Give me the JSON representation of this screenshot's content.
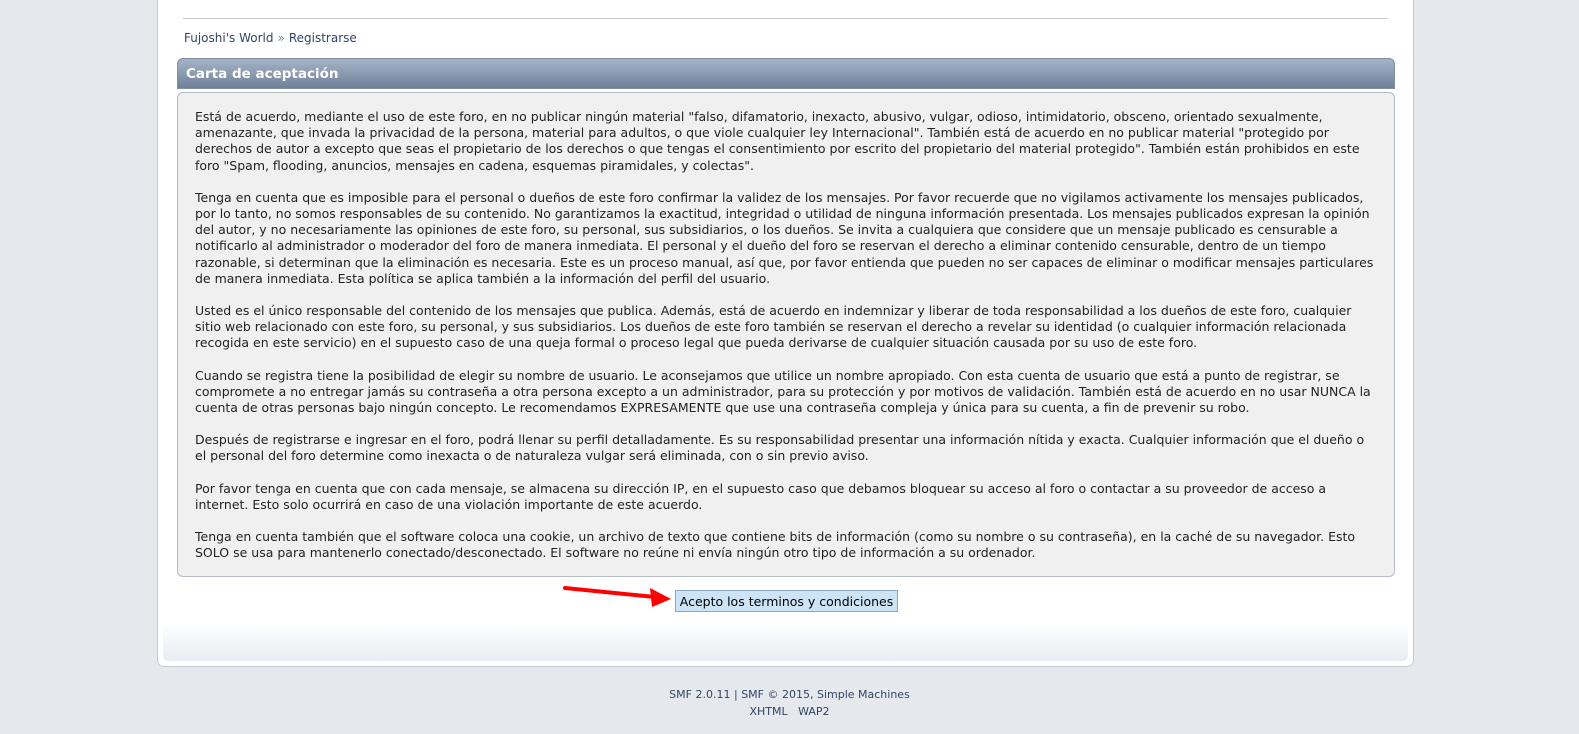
{
  "breadcrumb": {
    "home": "Fujoshi's World",
    "separator": "»",
    "current": "Registrarse"
  },
  "agreement": {
    "title": "Carta de aceptación",
    "paragraphs": [
      "Está de acuerdo, mediante el uso de este foro, en no publicar ningún material \"falso, difamatorio, inexacto, abusivo, vulgar, odioso, intimidatorio, obsceno, orientado sexualmente, amenazante, que invada la privacidad de la persona, material para adultos, o que viole cualquier ley Internacional\". También está de acuerdo en no publicar material \"protegido por derechos de autor a excepto que seas el propietario de los derechos o que tengas el consentimiento por escrito del propietario del material protegido\". También están prohibidos en este foro \"Spam, flooding, anuncios, mensajes en cadena, esquemas piramidales, y colectas\".",
      "Tenga en cuenta que es imposible para el personal o dueños de este foro confirmar la validez de los mensajes. Por favor recuerde que no vigilamos activamente los mensajes publicados, por lo tanto, no somos responsables de su contenido. No garantizamos la exactitud, integridad o utilidad de ninguna información presentada. Los mensajes publicados expresan la opinión del autor, y no necesariamente las opiniones de este foro, su personal, sus subsidiarios, o los dueños. Se invita a cualquiera que considere que un mensaje publicado es censurable a notificarlo al administrador o moderador del foro de manera inmediata. El personal y el dueño del foro se reservan el derecho a eliminar contenido censurable, dentro de un tiempo razonable, si determinan que la eliminación es necesaria. Este es un proceso manual, así que, por favor entienda que pueden no ser capaces de eliminar o modificar mensajes particulares de manera inmediata. Esta política se aplica también a la información del perfil del usuario.",
      "Usted es el único responsable del contenido de los mensajes que publica. Además, está de acuerdo en indemnizar y liberar de toda responsabilidad a los dueños de este foro, cualquier sitio web relacionado con este foro, su personal, y sus subsidiarios. Los dueños de este foro también se reservan el derecho a revelar su identidad (o cualquier información relacionada recogida en este servicio) en el supuesto caso de una queja formal o proceso legal que pueda derivarse de cualquier situación causada por su uso de este foro.",
      "Cuando se registra tiene la posibilidad de elegir su nombre de usuario. Le aconsejamos que utilice un nombre apropiado. Con esta cuenta de usuario que está a punto de registrar, se compromete a no entregar jamás su contraseña a otra persona excepto a un administrador, para su protección y por motivos de validación. También está de acuerdo en no usar NUNCA la cuenta de otras personas bajo ningún concepto. Le recomendamos EXPRESAMENTE que use una contraseña compleja y única para su cuenta, a fin de prevenir su robo.",
      "Después de registrarse e ingresar en el foro, podrá llenar su perfil detalladamente. Es su responsabilidad presentar una información nítida y exacta. Cualquier información que el dueño o el personal del foro determine como inexacta o de naturaleza vulgar será eliminada, con o sin previo aviso.",
      "Por favor tenga en cuenta que con cada mensaje, se almacena su dirección IP, en el supuesto caso que debamos bloquear su acceso al foro o contactar a su proveedor de acceso a internet. Esto solo ocurrirá en caso de una violación importante de este acuerdo.",
      "Tenga en cuenta también que el software coloca una cookie, un archivo de texto que contiene bits de información (como su nombre o su contraseña), en la caché de su navegador. Esto SOLO se usa para mantenerlo conectado/desconectado. El software no reúne ni envía ningún otro tipo de información a su ordenador."
    ]
  },
  "accept_button": "Acepto los terminos y condiciones",
  "footer": {
    "version_link": "SMF 2.0.11",
    "divider": "|",
    "copyright_link": "SMF © 2015, Simple Machines",
    "xhtml_link": "XHTML",
    "wap2_link": "WAP2"
  },
  "colors": {
    "header_bar": "#8b9bb0",
    "button_bg": "#cde4f7",
    "arrow": "#ff0000",
    "page_bg": "#e5e9ee"
  },
  "icons": {
    "annotation_arrow": "red-arrow-icon"
  }
}
